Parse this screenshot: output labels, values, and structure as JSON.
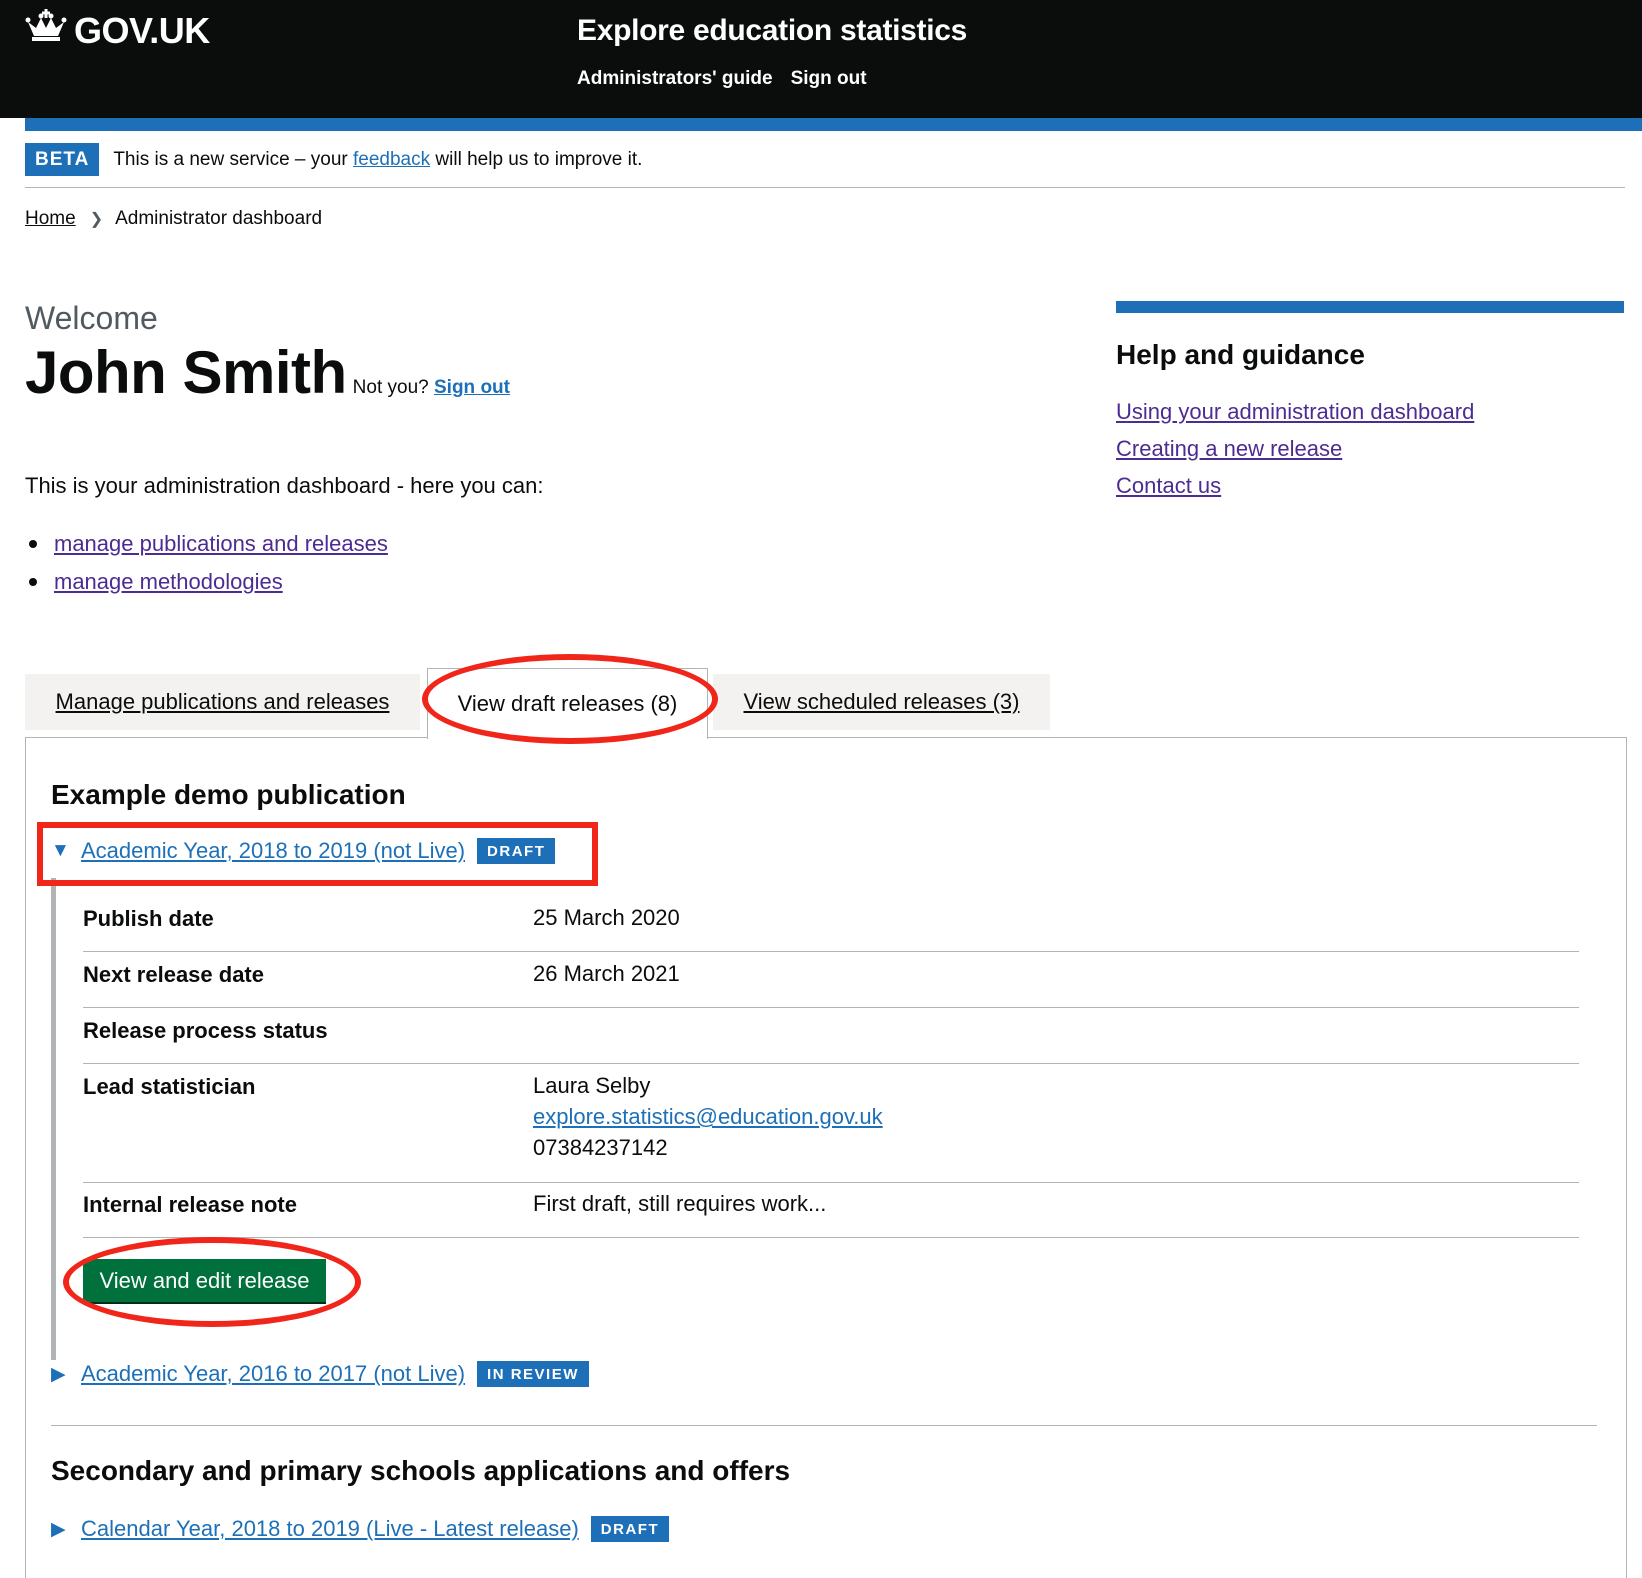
{
  "header": {
    "logo_text": "GOV.UK",
    "logo_icon": "crown-icon",
    "service_name": "Explore education statistics",
    "nav": [
      "Administrators' guide",
      "Sign out"
    ]
  },
  "beta": {
    "tag": "BETA",
    "text_before": "This is a new service – your",
    "link": "feedback",
    "text_after": "will help us to improve it."
  },
  "breadcrumb": {
    "home": "Home",
    "current": "Administrator dashboard"
  },
  "welcome": {
    "greeting": "Welcome",
    "name": "John Smith",
    "not_you": "Not you?",
    "sign_out": "Sign out",
    "intro": "This is your administration dashboard - here you can:",
    "links": [
      "manage publications and releases",
      "manage methodologies"
    ]
  },
  "help": {
    "title": "Help and guidance",
    "links": [
      "Using your administration dashboard",
      "Creating a new release",
      "Contact us"
    ]
  },
  "tabs": [
    {
      "label": "Manage publications and releases",
      "selected": false
    },
    {
      "label": "View draft releases (8)",
      "selected": true
    },
    {
      "label": "View scheduled releases (3)",
      "selected": false
    }
  ],
  "panel": {
    "publications": [
      {
        "title": "Example demo publication",
        "releases": [
          {
            "label": "Academic Year, 2018 to 2019 (not Live)",
            "tag": "DRAFT",
            "expanded": true,
            "details": {
              "publish_date_label": "Publish date",
              "publish_date": "25 March 2020",
              "next_release_label": "Next release date",
              "next_release": "26 March 2021",
              "status_label": "Release process status",
              "status": "",
              "lead_label": "Lead statistician",
              "lead_name": "Laura Selby",
              "lead_email": "explore.statistics@education.gov.uk",
              "lead_phone": "07384237142",
              "note_label": "Internal release note",
              "note": "First draft, still requires work..."
            },
            "button": "View and edit release"
          },
          {
            "label": "Academic Year, 2016 to 2017 (not Live)",
            "tag": "IN REVIEW",
            "expanded": false
          }
        ]
      },
      {
        "title": "Secondary and primary schools applications and offers",
        "releases": [
          {
            "label": "Calendar Year, 2018 to 2019 (Live - Latest release)",
            "tag": "DRAFT",
            "expanded": false
          }
        ]
      }
    ]
  },
  "colors": {
    "brand_blue": "#1d70b8",
    "header_black": "#0b0c0c",
    "button_green": "#00703c",
    "annotation_red": "#f0261a",
    "visited_link": "#4c2c92"
  }
}
